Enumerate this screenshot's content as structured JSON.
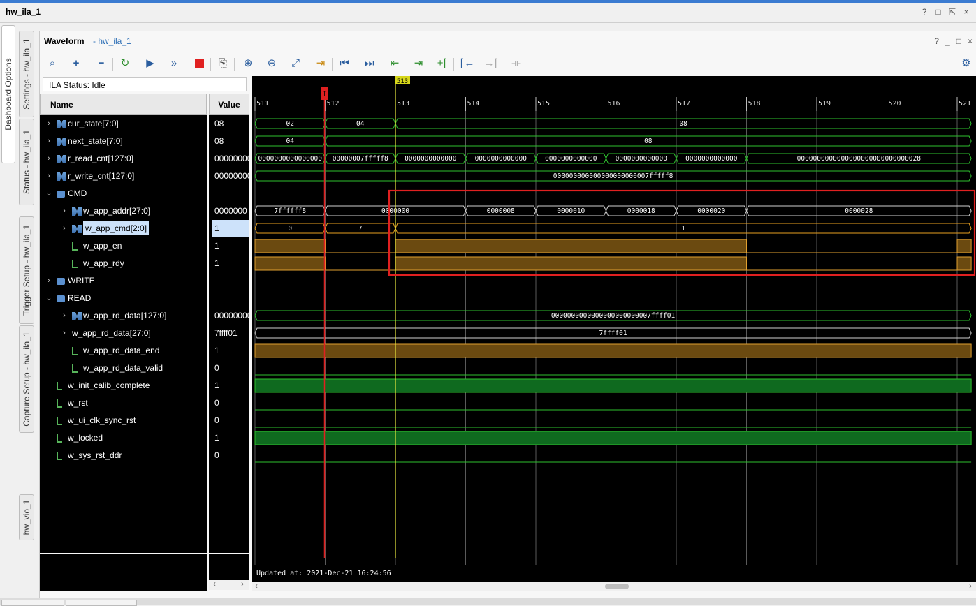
{
  "window": {
    "title": "hw_ila_1"
  },
  "left_tabs": [
    {
      "label": "Dashboard Options"
    },
    {
      "label": "Settings - hw_ila_1"
    },
    {
      "label": "Status - hw_ila_1"
    },
    {
      "label": "Trigger Setup - hw_ila_1"
    },
    {
      "label": "Capture Setup - hw_ila_1"
    },
    {
      "label": "hw_vio_1"
    }
  ],
  "panel": {
    "title": "Waveform",
    "subtitle": "- hw_ila_1",
    "window_controls": [
      "?",
      "_",
      "□",
      "×"
    ]
  },
  "toolbar": {
    "icons": [
      "search-icon",
      "add-icon",
      "remove-icon",
      "refresh-icon",
      "run-trigger-icon",
      "run-immediate-icon",
      "stop-icon",
      "export-icon",
      "zoom-in-icon",
      "zoom-out-icon",
      "zoom-fit-icon",
      "go-to-cursor-icon",
      "go-to-time-zero-icon",
      "go-to-last-time-icon",
      "previous-transition-icon",
      "next-transition-icon",
      "add-marker-icon",
      "previous-marker-icon",
      "next-marker-icon",
      "swap-cursors-icon",
      "settings-gear-icon"
    ]
  },
  "ila_status": "ILA Status:  Idle",
  "columns": {
    "name": "Name",
    "value": "Value"
  },
  "signals": [
    {
      "name": "cur_state[7:0]",
      "value": "08",
      "indent": 0,
      "icon": "bus",
      "expandable": true
    },
    {
      "name": "next_state[7:0]",
      "value": "08",
      "indent": 0,
      "icon": "bus",
      "expandable": true
    },
    {
      "name": "r_read_cnt[127:0]",
      "value": "00000000",
      "indent": 0,
      "icon": "bus",
      "expandable": true
    },
    {
      "name": "r_write_cnt[127:0]",
      "value": "00000000",
      "indent": 0,
      "icon": "bus",
      "expandable": true
    },
    {
      "name": "CMD",
      "value": "",
      "indent": 0,
      "icon": "group",
      "expanded": true
    },
    {
      "name": "w_app_addr[27:0]",
      "value": "0000000",
      "indent": 1,
      "icon": "bus",
      "expandable": true
    },
    {
      "name": "w_app_cmd[2:0]",
      "value": "1",
      "indent": 1,
      "icon": "bus",
      "expandable": true,
      "selected": true
    },
    {
      "name": "w_app_en",
      "value": "1",
      "indent": 1,
      "icon": "bit"
    },
    {
      "name": "w_app_rdy",
      "value": "1",
      "indent": 1,
      "icon": "bit"
    },
    {
      "name": "WRITE",
      "value": "",
      "indent": 0,
      "icon": "group",
      "expandable": true
    },
    {
      "name": "READ",
      "value": "",
      "indent": 0,
      "icon": "group",
      "expanded": true
    },
    {
      "name": "w_app_rd_data[127:0]",
      "value": "00000000",
      "indent": 1,
      "icon": "bus",
      "expandable": true
    },
    {
      "name": "w_app_rd_data[27:0]",
      "value": "7ffff01",
      "indent": 1,
      "icon": "none",
      "expandable": true
    },
    {
      "name": "w_app_rd_data_end",
      "value": "1",
      "indent": 1,
      "icon": "bit"
    },
    {
      "name": "w_app_rd_data_valid",
      "value": "0",
      "indent": 1,
      "icon": "bit"
    },
    {
      "name": "w_init_calib_complete",
      "value": "1",
      "indent": 0,
      "icon": "bit"
    },
    {
      "name": "w_rst",
      "value": "0",
      "indent": 0,
      "icon": "bit"
    },
    {
      "name": "w_ui_clk_sync_rst",
      "value": "0",
      "indent": 0,
      "icon": "bit"
    },
    {
      "name": "w_locked",
      "value": "1",
      "indent": 0,
      "icon": "bit"
    },
    {
      "name": "w_sys_rst_ddr",
      "value": "0",
      "indent": 0,
      "icon": "bit"
    }
  ],
  "timeline": {
    "ticks": [
      "511",
      "512",
      "513",
      "514",
      "515",
      "516",
      "517",
      "518",
      "519",
      "520",
      "521"
    ],
    "trigger_marker": "T",
    "cursor_label": "513"
  },
  "waves": {
    "cur_state": [
      [
        "02",
        511,
        512
      ],
      [
        "04",
        512,
        513
      ],
      [
        "08",
        513,
        521.2
      ]
    ],
    "next_state": [
      [
        "04",
        511,
        512
      ],
      [
        "08",
        512,
        521.2
      ]
    ],
    "r_read_cnt": [
      [
        "0000000000000000",
        511,
        512
      ],
      [
        "00000007fffff8",
        512,
        513
      ],
      [
        "0000000000000",
        513,
        514
      ],
      [
        "0000000000000",
        514,
        515
      ],
      [
        "0000000000000",
        515,
        516
      ],
      [
        "0000000000000",
        516,
        517
      ],
      [
        "0000000000000",
        517,
        518
      ],
      [
        "0000000000000000000000000000028",
        518,
        521.2
      ]
    ],
    "r_write_cnt": [
      [
        "000000000000000000000007fffff8",
        511,
        521.2
      ]
    ],
    "w_app_addr": [
      [
        "7ffffff8",
        511,
        512
      ],
      [
        "0000000",
        512,
        514
      ],
      [
        "0000008",
        514,
        515
      ],
      [
        "0000010",
        515,
        516
      ],
      [
        "0000018",
        516,
        517
      ],
      [
        "0000020",
        517,
        518
      ],
      [
        "0000028",
        518,
        521.2
      ]
    ],
    "w_app_cmd": [
      [
        "0",
        511,
        512
      ],
      [
        "7",
        512,
        513
      ],
      [
        "1",
        513,
        521.2
      ]
    ],
    "w_app_rd_data_128": [
      [
        "0000000000000000000000007ffff01",
        511,
        521.2
      ]
    ],
    "w_app_rd_data_28": [
      [
        "7ffff01",
        511,
        521.2
      ]
    ]
  },
  "bits": {
    "w_app_en": [
      [
        511,
        512,
        1
      ],
      [
        512,
        513,
        0
      ],
      [
        513,
        518,
        1
      ],
      [
        518,
        521,
        0
      ],
      [
        521,
        521.2,
        1
      ]
    ],
    "w_app_rdy": [
      [
        511,
        512,
        1
      ],
      [
        512,
        513,
        0
      ],
      [
        513,
        518,
        1
      ],
      [
        518,
        521,
        0
      ],
      [
        521,
        521.2,
        1
      ]
    ],
    "w_app_rd_data_end": [
      [
        511,
        521.2,
        1
      ]
    ],
    "w_app_rd_data_valid": [
      [
        511,
        521.2,
        0
      ]
    ],
    "w_init_calib_complete": [
      [
        511,
        521.2,
        1
      ]
    ],
    "w_rst": [
      [
        511,
        521.2,
        0
      ]
    ],
    "w_ui_clk_sync_rst": [
      [
        511,
        521.2,
        0
      ]
    ],
    "w_locked": [
      [
        511,
        521.2,
        1
      ]
    ],
    "w_sys_rst_ddr": [
      [
        511,
        521.2,
        0
      ]
    ]
  },
  "updated_at": "Updated at:  2021-Dec-21 16:24:56",
  "colors": {
    "bus": "#2ec02e",
    "bus_highlight": "#e8a020",
    "bit_high_fill": "#6b4a10",
    "bit_high_stroke": "#e0a030",
    "bit_green_fill": "#0f6a1f",
    "trigger": "#e02020",
    "cursor": "#e8e840",
    "annotation_box": "#e02020"
  }
}
